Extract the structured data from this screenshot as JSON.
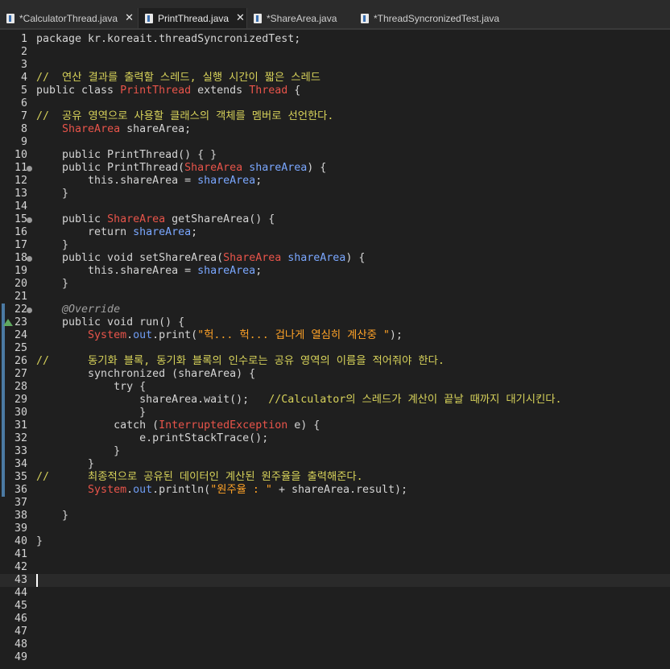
{
  "tabs": [
    {
      "label": "*CalculatorThread.java",
      "closable": true,
      "active": false
    },
    {
      "label": "PrintThread.java",
      "closable": true,
      "active": true
    },
    {
      "label": "*ShareArea.java",
      "closable": false,
      "active": false
    },
    {
      "label": "*ThreadSyncronizedTest.java",
      "closable": false,
      "active": false
    }
  ],
  "close_glyph": "✕",
  "line_numbers": [
    "1",
    "2",
    "3",
    "4",
    "5",
    "6",
    "7",
    "8",
    "9",
    "10",
    "11",
    "12",
    "13",
    "14",
    "15",
    "16",
    "17",
    "18",
    "19",
    "20",
    "21",
    "22",
    "23",
    "24",
    "25",
    "26",
    "27",
    "28",
    "29",
    "30",
    "31",
    "32",
    "33",
    "34",
    "35",
    "36",
    "37",
    "38",
    "39",
    "40",
    "41",
    "42",
    "43",
    "44",
    "45",
    "46",
    "47",
    "48",
    "49"
  ],
  "code": {
    "l1_package": "package kr.koreait.threadSyncronizedTest;",
    "l4_comment": "//  연산 결과를 출력할 스레드, 실행 시간이 짧은 스레드",
    "l5_a": "public class ",
    "l5_b": "PrintThread",
    "l5_c": " extends ",
    "l5_d": "Thread",
    "l5_e": " {",
    "l7_comment": "//  공유 영역으로 사용할 클래스의 객체를 멤버로 선언한다.",
    "l8_a": "    ",
    "l8_b": "ShareArea",
    "l8_c": " shareArea;",
    "l10": "    public PrintThread() { }",
    "l11_a": "    public PrintThread(",
    "l11_b": "ShareArea",
    "l11_c": " ",
    "l11_d": "shareArea",
    "l11_e": ") {",
    "l12_a": "        this.shareArea = ",
    "l12_b": "shareArea",
    "l12_c": ";",
    "l13": "    }",
    "l15_a": "    public ",
    "l15_b": "ShareArea",
    "l15_c": " getShareArea() {",
    "l16_a": "        return ",
    "l16_b": "shareArea",
    "l16_c": ";",
    "l17": "    }",
    "l18_a": "    public void setShareArea(",
    "l18_b": "ShareArea",
    "l18_c": " ",
    "l18_d": "shareArea",
    "l18_e": ") {",
    "l19_a": "        this.shareArea = ",
    "l19_b": "shareArea",
    "l19_c": ";",
    "l20": "    }",
    "l22": "    @Override",
    "l23": "    public void run() {",
    "l24_a": "        ",
    "l24_b": "System",
    "l24_c": ".",
    "l24_d": "out",
    "l24_e": ".print(",
    "l24_f": "\"헉... 헉... 겁나게 열심히 계산중 \"",
    "l24_g": ");",
    "l26_comment": "//      동기화 블록, 동기화 블록의 인수로는 공유 영역의 이름을 적어줘야 한다.",
    "l27": "        synchronized (shareArea) {",
    "l28": "            try {",
    "l29_a": "                shareArea.wait();   ",
    "l29_b": "//Calculator의 스레드가 계산이 끝날 때까지 대기시킨다.",
    "l30": "                }",
    "l31_a": "            catch (",
    "l31_b": "InterruptedException",
    "l31_c": " e) {",
    "l32": "                e.printStackTrace();",
    "l33": "            }",
    "l34": "        }",
    "l35_comment": "//      최종적으로 공유된 데이터인 계산된 원주율을 출력해준다.",
    "l36_a": "        ",
    "l36_b": "System",
    "l36_c": ".",
    "l36_d": "out",
    "l36_e": ".println(",
    "l36_f": "\"원주율 : \"",
    "l36_g": " + shareArea.result);",
    "l38": "    }",
    "l40": "}"
  },
  "colors": {
    "background": "#1f1f1f",
    "comment": "#d7d25a",
    "type": "#e8544a",
    "field": "#6f9cf3",
    "string": "#ffa227",
    "current_line": "#2a2a2a"
  }
}
